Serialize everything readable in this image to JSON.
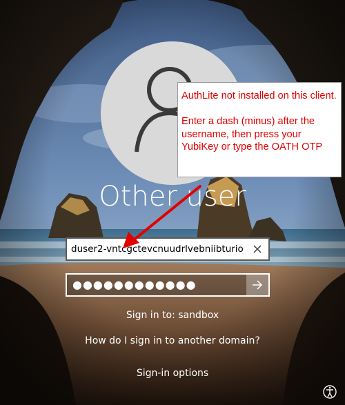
{
  "login": {
    "user_title": "Other user",
    "username_value": "duser2-vntcgctevcnuudrlvebniibturio",
    "password_dots": "●●●●●●●●●●●●",
    "sign_in_to": "Sign in to: sandbox",
    "how_link": "How do I sign in to another domain?",
    "options_link": "Sign-in options"
  },
  "callout": {
    "line1": "AuthLite not installed on this client.",
    "line2": "Enter a dash (minus) after the username, then press your YubiKey or type the OATH OTP"
  },
  "icons": {
    "avatar": "user-silhouette-icon",
    "clear": "close-icon",
    "submit": "arrow-right-icon",
    "accessibility": "ease-of-access-icon"
  },
  "colors": {
    "callout_text": "#e00000",
    "arrow": "#e00000",
    "avatar_bg": "#d9d9d9"
  }
}
